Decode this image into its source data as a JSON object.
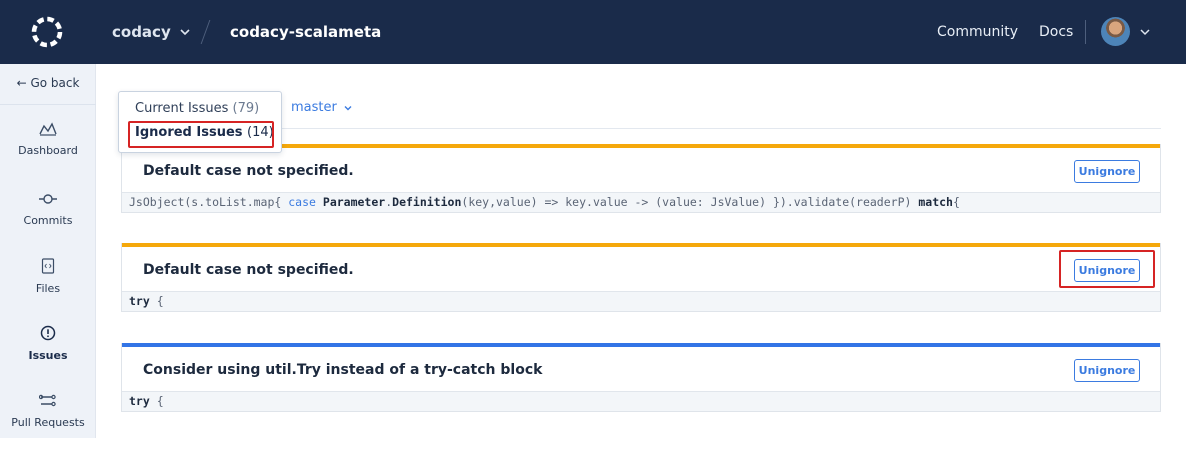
{
  "topbar": {
    "organization": "codacy",
    "repository": "codacy-scalameta",
    "nav": [
      "Community",
      "Docs"
    ]
  },
  "sidebar": {
    "go_back": "← Go back",
    "items": [
      {
        "label": "Dashboard",
        "icon": "dashboard-icon"
      },
      {
        "label": "Commits",
        "icon": "commit-icon"
      },
      {
        "label": "Files",
        "icon": "file-icon"
      },
      {
        "label": "Issues",
        "icon": "issues-icon",
        "active": true
      },
      {
        "label": "Pull Requests",
        "icon": "pull-request-icon"
      }
    ]
  },
  "filter": {
    "options": [
      {
        "label": "Current Issues",
        "count": "(79)"
      },
      {
        "label": "Ignored Issues",
        "count": "(14)",
        "selected": true
      }
    ],
    "branch": "master"
  },
  "issues": [
    {
      "title": "Default case not specified.",
      "severity_color": "#f5a80b",
      "action": "Unignore",
      "code_parts": [
        {
          "t": "JsObject(s.toList.map{ ",
          "s": "n"
        },
        {
          "t": "case",
          "s": "k"
        },
        {
          "t": " ",
          "s": "n"
        },
        {
          "t": "Parameter",
          "s": "b"
        },
        {
          "t": ".",
          "s": "n"
        },
        {
          "t": "Definition",
          "s": "b"
        },
        {
          "t": "(key,value) => key.value -> (value: JsValue) }).validate(readerP) ",
          "s": "n"
        },
        {
          "t": "match",
          "s": "b"
        },
        {
          "t": "{",
          "s": "n"
        }
      ]
    },
    {
      "title": "Default case not specified.",
      "severity_color": "#f5a80b",
      "action": "Unignore",
      "code_parts": [
        {
          "t": "try",
          "s": "b"
        },
        {
          "t": " {",
          "s": "n"
        }
      ]
    },
    {
      "title": "Consider using util.Try instead of a try-catch block",
      "severity_color": "#3274e6",
      "action": "Unignore",
      "code_parts": [
        {
          "t": "try",
          "s": "b"
        },
        {
          "t": " {",
          "s": "n"
        }
      ]
    }
  ],
  "colors": {
    "topbar": "#1a2b4a",
    "accent": "#3b7be0",
    "highlight": "#d62424"
  }
}
